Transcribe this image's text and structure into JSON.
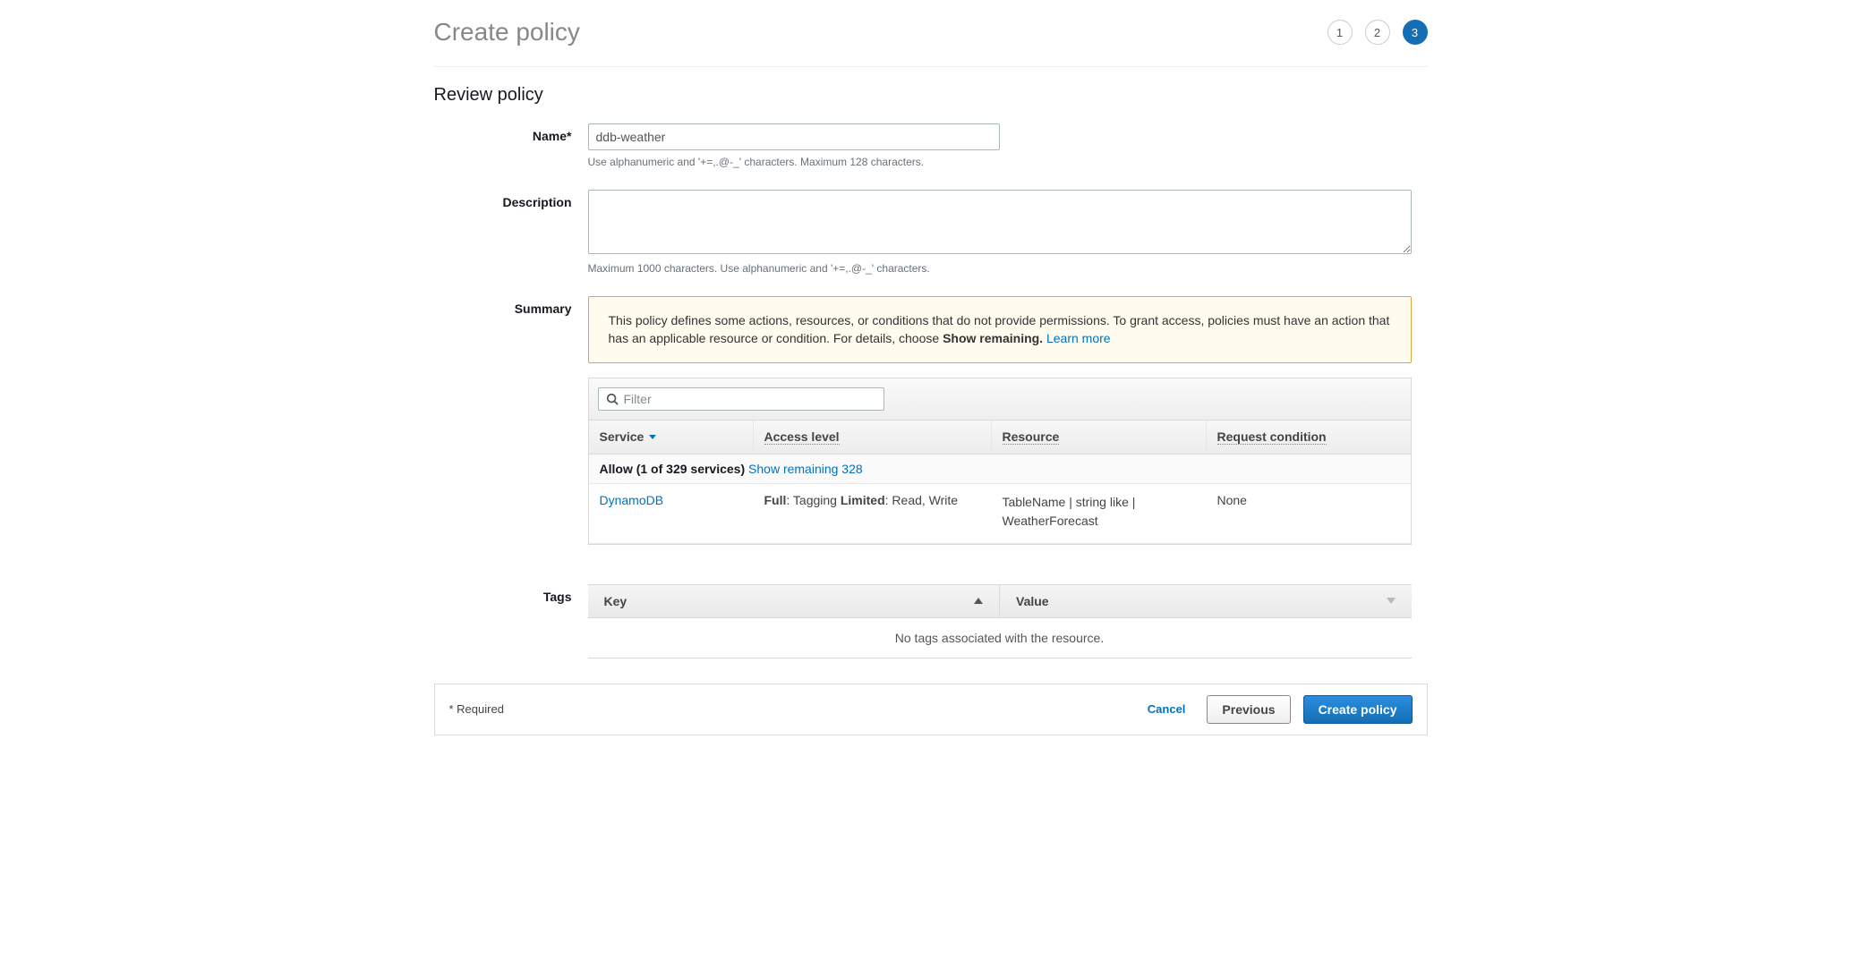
{
  "header": {
    "title": "Create policy",
    "steps": [
      "1",
      "2",
      "3"
    ],
    "active_step_index": 2
  },
  "section": {
    "review_title": "Review policy"
  },
  "form": {
    "name_label": "Name*",
    "name_value": "ddb-weather",
    "name_hint": "Use alphanumeric and '+=,.@-_' characters. Maximum 128 characters.",
    "description_label": "Description",
    "description_value": "",
    "description_hint": "Maximum 1000 characters. Use alphanumeric and '+=,.@-_' characters.",
    "summary_label": "Summary",
    "tags_label": "Tags"
  },
  "warning": {
    "text_pre": "This policy defines some actions, resources, or conditions that do not provide permissions. To grant access, policies must have an action that has an applicable resource or condition. For details, choose ",
    "bold": "Show remaining.",
    "learn_more": "Learn more"
  },
  "summary_table": {
    "filter_placeholder": "Filter",
    "columns": {
      "service": "Service",
      "access": "Access level",
      "resource": "Resource",
      "request": "Request condition"
    },
    "allow_row": {
      "bold": "Allow (1 of 329 services)",
      "link": "Show remaining 328"
    },
    "row": {
      "service": "DynamoDB",
      "access_full_label": "Full",
      "access_full_vals": ": Tagging ",
      "access_limited_label": "Limited",
      "access_limited_vals": ": Read, Write",
      "resource": "TableName | string like | WeatherForecast",
      "request": "None"
    }
  },
  "tags_table": {
    "col_key": "Key",
    "col_value": "Value",
    "empty": "No tags associated with the resource."
  },
  "footer": {
    "required": "* Required",
    "cancel": "Cancel",
    "previous": "Previous",
    "create": "Create policy"
  }
}
